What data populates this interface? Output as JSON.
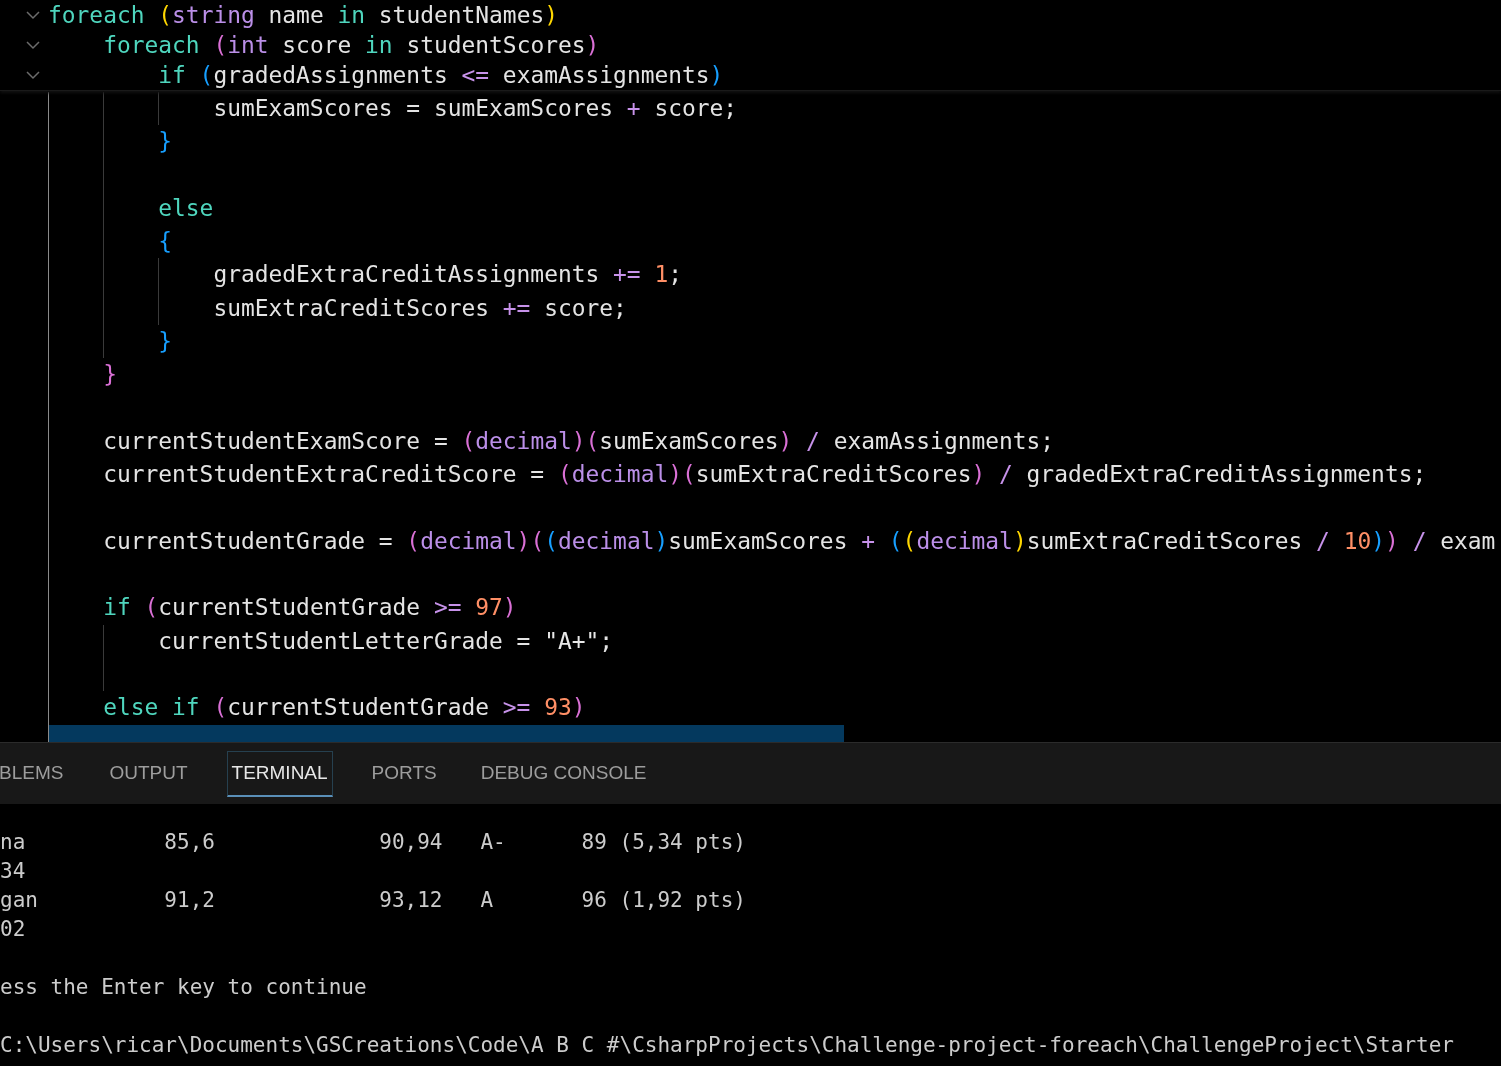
{
  "editor": {
    "sticky_lines": [
      {
        "tokens": [
          {
            "text": "foreach ",
            "kind": "kw"
          },
          {
            "text": "(",
            "kind": "by"
          },
          {
            "text": "string",
            "kind": "type"
          },
          {
            "text": " name ",
            "kind": "id"
          },
          {
            "text": "in",
            "kind": "kw"
          },
          {
            "text": " studentNames",
            "kind": "id"
          },
          {
            "text": ")",
            "kind": "by"
          }
        ]
      },
      {
        "tokens": [
          {
            "text": "    foreach ",
            "kind": "kw"
          },
          {
            "text": "(",
            "kind": "bp"
          },
          {
            "text": "int",
            "kind": "type"
          },
          {
            "text": " score ",
            "kind": "id"
          },
          {
            "text": "in",
            "kind": "kw"
          },
          {
            "text": " studentScores",
            "kind": "id"
          },
          {
            "text": ")",
            "kind": "bp"
          }
        ]
      },
      {
        "tokens": [
          {
            "text": "        if ",
            "kind": "kw"
          },
          {
            "text": "(",
            "kind": "bb"
          },
          {
            "text": "gradedAssignments ",
            "kind": "id"
          },
          {
            "text": "<=",
            "kind": "op"
          },
          {
            "text": " examAssignments",
            "kind": "id"
          },
          {
            "text": ")",
            "kind": "bb"
          }
        ]
      }
    ],
    "lines": [
      {
        "selected": false,
        "tokens": [
          {
            "text": "            sumExamScores = sumExamScores ",
            "kind": "id"
          },
          {
            "text": "+",
            "kind": "op"
          },
          {
            "text": " score;",
            "kind": "id"
          }
        ]
      },
      {
        "selected": false,
        "tokens": [
          {
            "text": "        }",
            "kind": "bb"
          }
        ]
      },
      {
        "selected": false
      },
      {
        "selected": false,
        "tokens": [
          {
            "text": "        else",
            "kind": "kw"
          }
        ]
      },
      {
        "selected": false,
        "tokens": [
          {
            "text": "        {",
            "kind": "bb"
          }
        ]
      },
      {
        "selected": false,
        "tokens": [
          {
            "text": "            gradedExtraCreditAssignments ",
            "kind": "id"
          },
          {
            "text": "+=",
            "kind": "op"
          },
          {
            "text": " 1",
            "kind": "num"
          },
          {
            "text": ";",
            "kind": "id"
          }
        ]
      },
      {
        "selected": false,
        "tokens": [
          {
            "text": "            sumExtraCreditScores ",
            "kind": "id"
          },
          {
            "text": "+=",
            "kind": "op"
          },
          {
            "text": " score;",
            "kind": "id"
          }
        ]
      },
      {
        "selected": false,
        "tokens": [
          {
            "text": "        }",
            "kind": "bb"
          }
        ]
      },
      {
        "selected": false,
        "tokens": [
          {
            "text": "    }",
            "kind": "bp"
          }
        ]
      },
      {
        "selected": false
      },
      {
        "selected": false,
        "tokens": [
          {
            "text": "    currentStudentExamScore = ",
            "kind": "id"
          },
          {
            "text": "(",
            "kind": "bp"
          },
          {
            "text": "decimal",
            "kind": "type"
          },
          {
            "text": ")(",
            "kind": "bp"
          },
          {
            "text": "sumExamScores",
            "kind": "id"
          },
          {
            "text": ")",
            "kind": "bp"
          },
          {
            "text": " /",
            "kind": "op"
          },
          {
            "text": " examAssignments;",
            "kind": "id"
          }
        ]
      },
      {
        "selected": false,
        "tokens": [
          {
            "text": "    currentStudentExtraCreditScore = ",
            "kind": "id"
          },
          {
            "text": "(",
            "kind": "bp"
          },
          {
            "text": "decimal",
            "kind": "type"
          },
          {
            "text": ")(",
            "kind": "bp"
          },
          {
            "text": "sumExtraCreditScores",
            "kind": "id"
          },
          {
            "text": ")",
            "kind": "bp"
          },
          {
            "text": " /",
            "kind": "op"
          },
          {
            "text": " gradedExtraCreditAssignments;",
            "kind": "id"
          }
        ]
      },
      {
        "selected": false
      },
      {
        "selected": false,
        "tokens": [
          {
            "text": "    currentStudentGrade = ",
            "kind": "id"
          },
          {
            "text": "(",
            "kind": "bp"
          },
          {
            "text": "decimal",
            "kind": "type"
          },
          {
            "text": ")(",
            "kind": "bp"
          },
          {
            "text": "(",
            "kind": "bb"
          },
          {
            "text": "decimal",
            "kind": "type"
          },
          {
            "text": ")",
            "kind": "bb"
          },
          {
            "text": "sumExamScores ",
            "kind": "id"
          },
          {
            "text": "+",
            "kind": "op"
          },
          {
            "text": " (",
            "kind": "bb"
          },
          {
            "text": "(",
            "kind": "by"
          },
          {
            "text": "decimal",
            "kind": "type"
          },
          {
            "text": ")",
            "kind": "by"
          },
          {
            "text": "sumExtraCreditScores ",
            "kind": "id"
          },
          {
            "text": "/",
            "kind": "op"
          },
          {
            "text": " 10",
            "kind": "num"
          },
          {
            "text": ")",
            "kind": "bb"
          },
          {
            "text": ")",
            "kind": "bp"
          },
          {
            "text": " /",
            "kind": "op"
          },
          {
            "text": " exam",
            "kind": "id"
          }
        ]
      },
      {
        "selected": false
      },
      {
        "selected": false,
        "tokens": [
          {
            "text": "    if ",
            "kind": "kw"
          },
          {
            "text": "(",
            "kind": "bp"
          },
          {
            "text": "currentStudentGrade ",
            "kind": "id"
          },
          {
            "text": ">=",
            "kind": "op"
          },
          {
            "text": " 97",
            "kind": "num"
          },
          {
            "text": ")",
            "kind": "bp"
          }
        ]
      },
      {
        "selected": false,
        "tokens": [
          {
            "text": "        currentStudentLetterGrade = ",
            "kind": "id"
          },
          {
            "text": "\"A+\"",
            "kind": "str"
          },
          {
            "text": ";",
            "kind": "id"
          }
        ]
      },
      {
        "selected": false
      },
      {
        "selected": false,
        "tokens": [
          {
            "text": "    else if ",
            "kind": "kw"
          },
          {
            "text": "(",
            "kind": "bp"
          },
          {
            "text": "currentStudentGrade ",
            "kind": "id"
          },
          {
            "text": ">=",
            "kind": "op"
          },
          {
            "text": " 93",
            "kind": "num"
          },
          {
            "text": ")",
            "kind": "bp"
          }
        ]
      },
      {
        "selected": true
      }
    ]
  },
  "panel": {
    "tabs": [
      {
        "label": "BLEMS",
        "selected": false
      },
      {
        "label": "OUTPUT",
        "selected": false
      },
      {
        "label": "TERMINAL",
        "selected": true
      },
      {
        "label": "PORTS",
        "selected": false
      },
      {
        "label": "DEBUG CONSOLE",
        "selected": false
      }
    ],
    "terminal_blocks": [
      [
        "na           85,6             90,94   A-      89 (5,34 pts)",
        "34",
        "gan          91,2             93,12   A       96 (1,92 pts)",
        "02"
      ],
      [
        "ess the Enter key to continue"
      ],
      [
        "C:\\Users\\ricar\\Documents\\GSCreations\\Code\\A B C #\\CsharpProjects\\Challenge-project-foreach\\ChallengeProject\\Starter"
      ]
    ]
  }
}
